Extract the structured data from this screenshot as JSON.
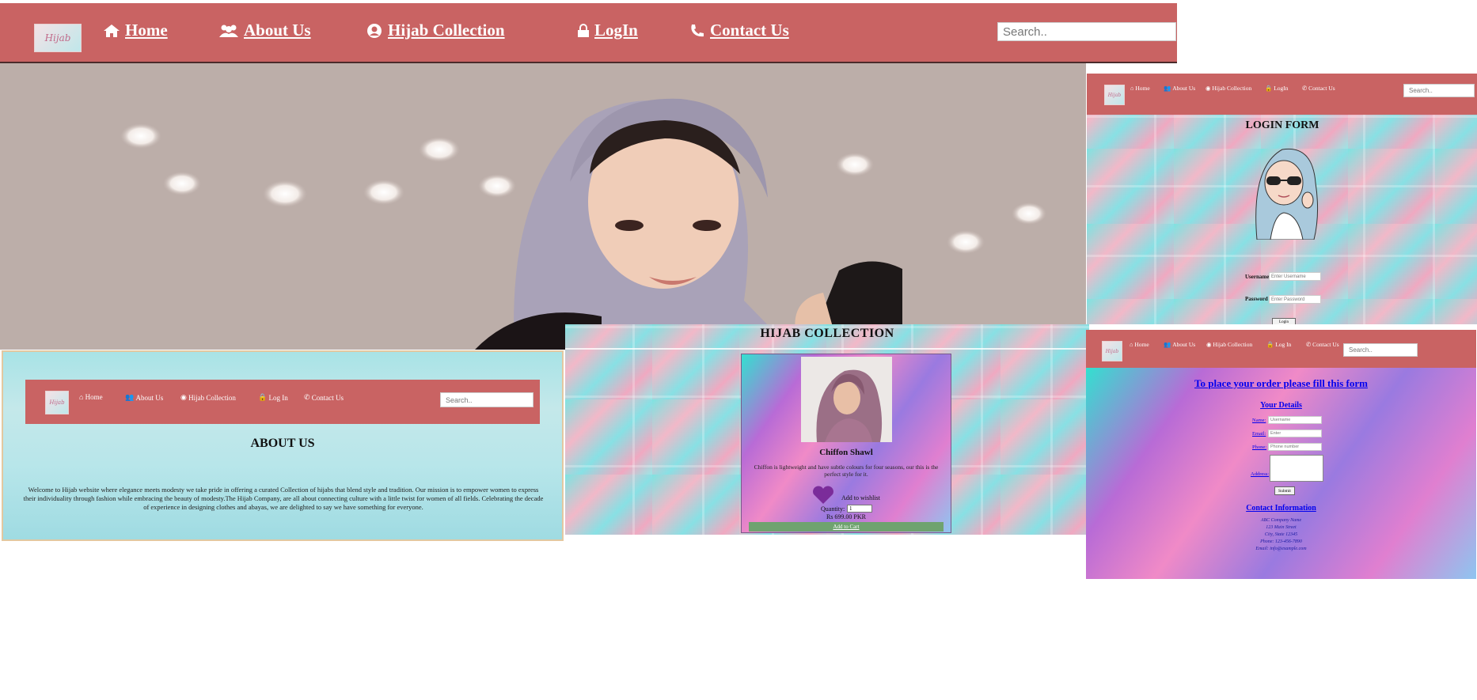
{
  "main_nav": {
    "logo_text": "Hijab",
    "links": [
      {
        "label": "Home",
        "icon": "home-icon"
      },
      {
        "label": "About Us",
        "icon": "users-icon"
      },
      {
        "label": "Hijab Collection",
        "icon": "user-circle-icon"
      },
      {
        "label": "LogIn",
        "icon": "lock-icon"
      },
      {
        "label": "Contact Us",
        "icon": "phone-icon"
      }
    ],
    "search_placeholder": "Search.."
  },
  "about_panel": {
    "nav_links": [
      "Home",
      "About Us",
      "Hijab Collection",
      "Log In",
      "Contact Us"
    ],
    "search_placeholder": "Search..",
    "title": "ABOUT US",
    "body": "Welcome to Hijab website where elegance meets modesty we take pride in offering a curated Collection of hijabs that blend style and tradition. Our mission is to empower women to express their individuality through fashion while embracing the beauty of modesty.The Hijab Company, are all about connecting culture with a little twist for women of all fields. Celebrating the decade of experience in designing clothes and abayas, we are delighted to say we have something for everyone."
  },
  "collection_panel": {
    "title": "HIJAB COLLECTION",
    "product_name": "Chiffon Shawl",
    "product_desc": "Chiffon is lightweight and have subtle colours for four seasons, our this is the perfect style for it.",
    "wishlist_label": "Add to wishlist",
    "quantity_label": "Quantity:",
    "quantity_value": "1",
    "price": "Rs 699.00 PKR",
    "cart_button": "Add to Cart"
  },
  "login_panel": {
    "nav_links": [
      "Home",
      "About Us",
      "Hijab Collection",
      "LogIn",
      "Contact Us"
    ],
    "search_placeholder": "Search..",
    "title": "LOGIN FORM",
    "username_label": "Username",
    "username_placeholder": "Enter Username",
    "password_label": "Password",
    "password_placeholder": "Enter Password",
    "login_button": "Login"
  },
  "order_panel": {
    "nav_links": [
      "Home",
      "About Us",
      "Hijab Collection",
      "Log In",
      "Contact Us"
    ],
    "search_placeholder": "Search..",
    "heading": "To place your order please fill this form",
    "details_heading": "Your Details",
    "fields": [
      {
        "label": "Name:",
        "placeholder": "Username"
      },
      {
        "label": "Email:",
        "placeholder": "Enter"
      },
      {
        "label": "Phone:",
        "placeholder": "Phone number"
      }
    ],
    "address_label": "Address:",
    "submit_label": "Submit",
    "contact_heading": "Contact Information",
    "contact_lines": [
      "ABC Company Name",
      "123 Main Street",
      "City, State 12345",
      "Phone: 123-456-7890",
      "Email: info@example.com"
    ]
  },
  "colors": {
    "nav_bg": "#c96363",
    "green_button": "#6fa36f",
    "heart": "#7b2c9a"
  }
}
